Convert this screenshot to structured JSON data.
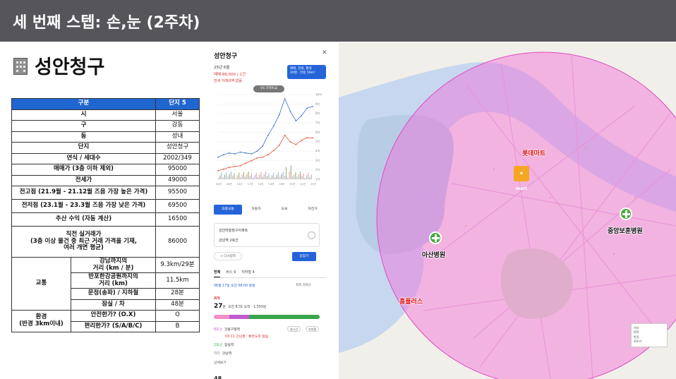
{
  "slide": {
    "title": "세 번째 스텝: 손,눈 (2주차)",
    "page_title": "성안청구"
  },
  "table": {
    "header": [
      "구분",
      "단지 5"
    ],
    "rows": [
      {
        "label": "시",
        "value": "서울"
      },
      {
        "label": "구",
        "value": "강동"
      },
      {
        "label": "동",
        "value": "성내"
      },
      {
        "label": "단지",
        "value": "성안청구"
      },
      {
        "label": "연식 / 세대수",
        "value": "2002/349"
      },
      {
        "label": "매매가 (3층 이하 제외)",
        "value": "95000"
      },
      {
        "label": "전세가",
        "value": "49000"
      },
      {
        "label": "전고점 (21.9월 - 21.12월 즈음 가장 높은 가격)",
        "value": "95500"
      },
      {
        "label": "전저점 (23.1월 - 23.3월 즈음 가장 낮은 가격)",
        "value": "69500"
      },
      {
        "label": "추산 수익 (자동 계산)",
        "value": "16500"
      },
      {
        "label": "직전 실거래가\n(3층 이상 물건 중 최근 거래 가격을 기재,\n여러 개면 평균)",
        "value": "86000"
      }
    ],
    "traffic": {
      "group": "교통",
      "rows": [
        {
          "label": "강남까지의\n거리 (km / 분)",
          "value": "9.3km/29분"
        },
        {
          "label": "반포한강공원까지의\n거리 (km)",
          "value": "11.5km"
        },
        {
          "label": "문정(송파) / 지하철",
          "value": "28분"
        },
        {
          "label": "잠실 / 차",
          "value": "48분"
        }
      ]
    },
    "env": {
      "group": "환경\n(반경 3km이내)",
      "rows": [
        {
          "label": "안전한가? (O.X)",
          "value": "O"
        },
        {
          "label": "편리한가? (S/A/B/C)",
          "value": "B"
        }
      ]
    }
  },
  "phone": {
    "title": "성안청구",
    "date": "25년 6월",
    "price": "매매 86,000 / 1건",
    "note": "전세 거래내역 없음",
    "filter_line1": "매매, 전세, 월세",
    "filter_line2": "20평 · 전용 59m²",
    "vs_button": "VS 가격비교",
    "chart_data": {
      "type": "line",
      "x_ticks": [
        "06년",
        "08년",
        "10년",
        "12년",
        "14년",
        "16년",
        "18년",
        "20년",
        "22년",
        "24년"
      ],
      "y_ticks": [
        "10억",
        "9억",
        "8억",
        "7억",
        "6억",
        "5억",
        "4억",
        "3억",
        "2억",
        "1억"
      ],
      "series": [
        {
          "color": "#3a6fd8",
          "values": [
            2.6,
            2.9,
            3.1,
            3.0,
            3.2,
            3.1,
            3.0,
            3.3,
            3.9,
            5.2,
            6.3,
            7.6,
            9.5,
            8.0,
            6.9,
            7.5,
            8.4,
            8.6
          ]
        },
        {
          "color": "#e0553a",
          "values": [
            1.0,
            1.2,
            1.4,
            1.5,
            1.6,
            1.9,
            2.2,
            2.5,
            2.6,
            2.9,
            3.4,
            4.0,
            5.2,
            4.4,
            4.1,
            4.6,
            4.9,
            4.9
          ]
        }
      ]
    },
    "route_tabs": [
      "대중교통",
      "자동차",
      "도보",
      "자전거"
    ],
    "route_from": "성안마을청구아파트",
    "route_to": "강남역 2호선",
    "via_label": "+ 다시입력",
    "search_label": "길찾기",
    "sub_tabs": [
      "전체",
      "버스 9",
      "지하철 4"
    ],
    "depart": "06월 17일 오전 08:00 출발",
    "sort": "최적 경로순",
    "section": "최적",
    "minutes": "27",
    "minutes_unit": "분",
    "minutes_detail": "오전 8:31 도착 · 1,550원",
    "steps": [
      {
        "label": "8호선",
        "text": "강동구청역"
      },
      {
        "label": "2호선",
        "text": "잠실역"
      },
      {
        "label": "하차",
        "text": "강남역"
      }
    ],
    "step_sub": "03:11 강남행 · 빠른도착 없음",
    "step_more": "상세보기",
    "pill1": "실시간",
    "pill2": "지하철",
    "bottom_value": "48"
  },
  "map": {
    "labels": {
      "lotte": "롯데마트",
      "asan": "아산병원",
      "central": "중앙보훈병원",
      "homeplus": "홈플러스",
      "emart": "e mart"
    },
    "controls": [
      "거리",
      "면적",
      "반경",
      "지우기"
    ],
    "circle_color": "#f36bd6"
  }
}
